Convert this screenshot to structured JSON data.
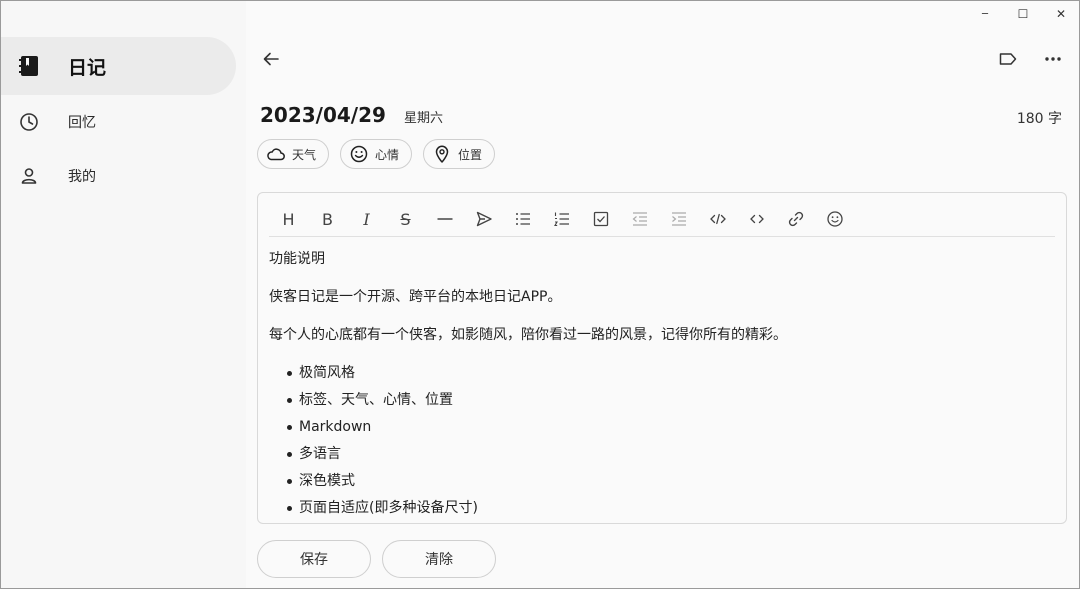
{
  "window": {
    "minimize_label": "─",
    "maximize_label": "☐",
    "close_label": "✕"
  },
  "sidebar": {
    "items": [
      {
        "label": "日记",
        "icon": "diary-book-icon",
        "active": true
      },
      {
        "label": "回忆",
        "icon": "clock-icon",
        "active": false
      },
      {
        "label": "我的",
        "icon": "person-icon",
        "active": false
      }
    ]
  },
  "header": {
    "back_icon": "arrow-left-icon",
    "tag_icon": "tag-icon",
    "more_icon": "more-horizontal-icon",
    "date": "2023/04/29",
    "weekday": "星期六",
    "word_count": "180 字"
  },
  "chips": [
    {
      "label": "天气",
      "icon": "cloud-icon"
    },
    {
      "label": "心情",
      "icon": "smiley-icon"
    },
    {
      "label": "位置",
      "icon": "location-pin-icon"
    }
  ],
  "toolbar": {
    "heading": "H",
    "bold": "B",
    "italic": "I",
    "strike": "S",
    "tools": [
      "heading",
      "bold",
      "italic",
      "strikethrough",
      "horizontal-rule",
      "send",
      "bullet-list",
      "ordered-list",
      "checkbox",
      "outdent",
      "indent",
      "code-block",
      "inline-code",
      "link",
      "emoji"
    ]
  },
  "editor": {
    "paragraphs": [
      "功能说明",
      "侠客日记是一个开源、跨平台的本地日记APP。",
      "每个人的心底都有一个侠客，如影随风，陪你看过一路的风景，记得你所有的精彩。"
    ],
    "bullets": [
      "极简风格",
      "标签、天气、心情、位置",
      "Markdown",
      "多语言",
      "深色模式",
      "页面自适应(即多种设备尺寸)"
    ]
  },
  "actions": {
    "save": "保存",
    "clear": "清除"
  }
}
